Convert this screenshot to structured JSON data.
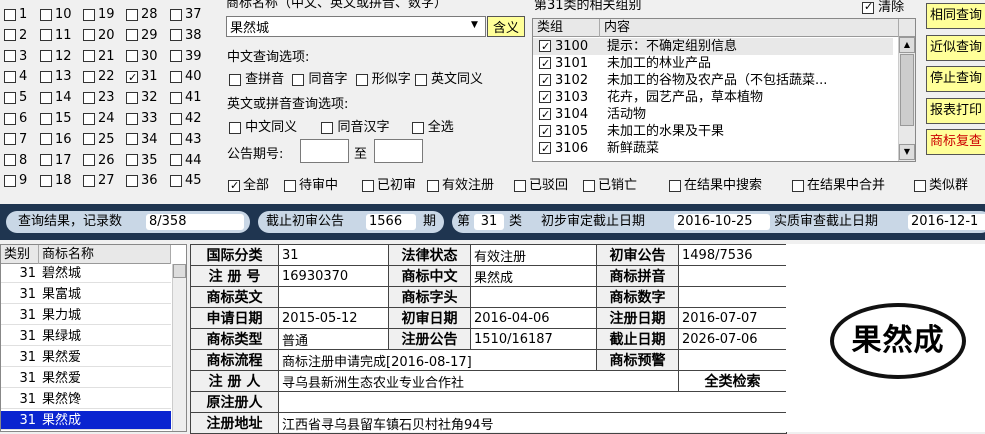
{
  "class_grid": {
    "rows": [
      [
        {
          "n": "1"
        },
        {
          "n": "10"
        },
        {
          "n": "19"
        },
        {
          "n": "28"
        },
        {
          "n": "37"
        }
      ],
      [
        {
          "n": "2"
        },
        {
          "n": "11"
        },
        {
          "n": "20"
        },
        {
          "n": "29"
        },
        {
          "n": "38"
        }
      ],
      [
        {
          "n": "3"
        },
        {
          "n": "12"
        },
        {
          "n": "21"
        },
        {
          "n": "30"
        },
        {
          "n": "39"
        }
      ],
      [
        {
          "n": "4"
        },
        {
          "n": "13"
        },
        {
          "n": "22"
        },
        {
          "n": "31",
          "checked": true
        },
        {
          "n": "40"
        }
      ],
      [
        {
          "n": "5"
        },
        {
          "n": "14"
        },
        {
          "n": "23"
        },
        {
          "n": "32"
        },
        {
          "n": "41"
        }
      ],
      [
        {
          "n": "6"
        },
        {
          "n": "15"
        },
        {
          "n": "24"
        },
        {
          "n": "33"
        },
        {
          "n": "42"
        }
      ],
      [
        {
          "n": "7"
        },
        {
          "n": "16"
        },
        {
          "n": "25"
        },
        {
          "n": "34"
        },
        {
          "n": "43"
        }
      ],
      [
        {
          "n": "8"
        },
        {
          "n": "17"
        },
        {
          "n": "26"
        },
        {
          "n": "35"
        },
        {
          "n": "44"
        }
      ],
      [
        {
          "n": "9"
        },
        {
          "n": "18"
        },
        {
          "n": "27"
        },
        {
          "n": "36"
        },
        {
          "n": "45"
        }
      ]
    ]
  },
  "name_search": {
    "label": "商标名称（中文、英文或拼音、数字）",
    "value": "果然城",
    "hanyi_button": "含义"
  },
  "cn_options": {
    "label": "中文查询选项:",
    "items": [
      "查拼音",
      "同音字",
      "形似字",
      "英文同义"
    ]
  },
  "en_options": {
    "label": "英文或拼音查询选项:",
    "items": [
      "中文同义",
      "同音汉字",
      "全选"
    ]
  },
  "gazette": {
    "label": "公告期号:",
    "to": "至",
    "from_value": "",
    "to_value": ""
  },
  "groups": {
    "title": "第31类的相关组别",
    "clear_label": "清除",
    "headers": {
      "group": "类组",
      "content": "内容"
    },
    "rows": [
      {
        "code": "3100",
        "content": "提示：不确定组别信息",
        "checked": true
      },
      {
        "code": "3101",
        "content": "未加工的林业产品",
        "checked": true
      },
      {
        "code": "3102",
        "content": "未加工的谷物及农产品（不包括蔬菜...",
        "checked": true
      },
      {
        "code": "3103",
        "content": "花卉，园艺产品，草本植物",
        "checked": true
      },
      {
        "code": "3104",
        "content": "活动物",
        "checked": true
      },
      {
        "code": "3105",
        "content": "未加工的水果及干果",
        "checked": true
      },
      {
        "code": "3106",
        "content": "新鲜蔬菜",
        "checked": true
      }
    ]
  },
  "right_buttons": [
    "相同查询",
    "近似查询",
    "停止查询",
    "报表打印",
    "商标复查"
  ],
  "filters": [
    "全部",
    "待审中",
    "已初审",
    "有效注册",
    "已驳回",
    "已销亡",
    "在结果中搜索",
    "在结果中合并",
    "类似群"
  ],
  "status_bar": {
    "result_label": "查询结果，记录数",
    "result_count": "8/358",
    "cutoff_label": "截止初审公告",
    "cutoff_value": "1566",
    "cutoff_unit": "期",
    "class_prefix": "第",
    "class_value": "31",
    "class_suffix": "类",
    "prelim_label": "初步审定截止日期",
    "prelim_date": "2016-10-25",
    "substantive_label": "实质审查截止日期",
    "substantive_date": "2016-12-1"
  },
  "result_list": {
    "headers": {
      "cls": "类别",
      "name": "商标名称"
    },
    "rows": [
      {
        "cls": "31",
        "name": "碧然城"
      },
      {
        "cls": "31",
        "name": "果富城"
      },
      {
        "cls": "31",
        "name": "果力城"
      },
      {
        "cls": "31",
        "name": "果绿城"
      },
      {
        "cls": "31",
        "name": "果然爱"
      },
      {
        "cls": "31",
        "name": "果然爱"
      },
      {
        "cls": "31",
        "name": "果然馋"
      },
      {
        "cls": "31",
        "name": "果然成",
        "selected": true
      }
    ]
  },
  "detail": {
    "intl_class_k": "国际分类",
    "intl_class_v": "31",
    "legal_status_k": "法律状态",
    "legal_status_v": "有效注册",
    "prelim_pub_k": "初审公告",
    "prelim_pub_v": "1498/7536",
    "reg_no_k": "注 册 号",
    "reg_no_v": "16930370",
    "tm_cn_k": "商标中文",
    "tm_cn_v": "果然成",
    "tm_pinyin_k": "商标拼音",
    "tm_pinyin_v": "",
    "tm_en_k": "商标英文",
    "tm_en_v": "",
    "tm_head_k": "商标字头",
    "tm_head_v": "",
    "tm_num_k": "商标数字",
    "tm_num_v": "",
    "apply_date_k": "申请日期",
    "apply_date_v": "2015-05-12",
    "prelim_date_k": "初审日期",
    "prelim_date_v": "2016-04-06",
    "reg_date_k": "注册日期",
    "reg_date_v": "2016-07-07",
    "tm_type_k": "商标类型",
    "tm_type_v": "普通",
    "reg_pub_k": "注册公告",
    "reg_pub_v": "1510/16187",
    "expiry_k": "截止日期",
    "expiry_v": "2026-07-06",
    "flow_k": "商标流程",
    "flow_v": "商标注册申请完成[2016-08-17]",
    "warning_k": "商标预警",
    "warning_v": "",
    "registrant_k": "注 册 人",
    "registrant_v": "寻乌县新洲生态农业专业合作社",
    "full_search": "全类检索",
    "orig_registrant_k": "原注册人",
    "orig_registrant_v": "",
    "address_k": "注册地址",
    "address_v": "江西省寻乌县留车镇石贝村社角94号"
  },
  "logo_text": "果然成"
}
